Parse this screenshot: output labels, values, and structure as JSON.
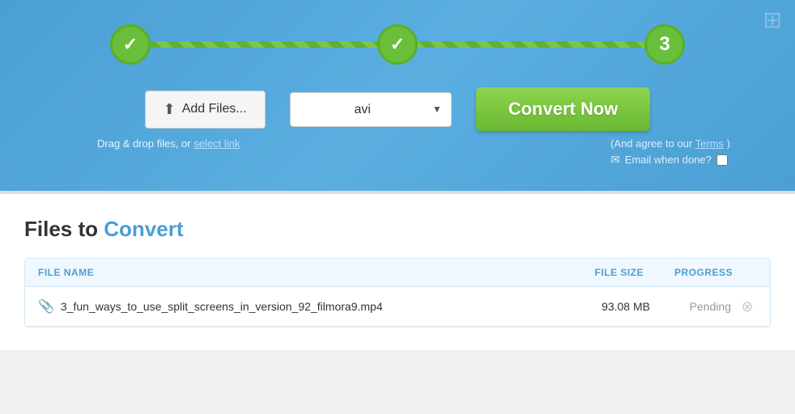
{
  "banner": {
    "steps": [
      {
        "id": 1,
        "state": "done",
        "label": "✓"
      },
      {
        "id": 2,
        "state": "done",
        "label": "✓"
      },
      {
        "id": 3,
        "state": "active",
        "label": "3"
      }
    ],
    "add_files_label": "Add Files...",
    "format_value": "avi",
    "convert_now_label": "Convert Now",
    "drag_drop_text": "Drag & drop files, or",
    "select_link_text": "select link",
    "terms_text": "(And agree to our",
    "terms_link_text": "Terms",
    "terms_close": ")",
    "email_label": "Email when done?"
  },
  "files_section": {
    "heading_part1": "Files to ",
    "heading_part2": "Convert",
    "table": {
      "col_filename": "FILE NAME",
      "col_filesize": "FILE SIZE",
      "col_progress": "PROGRESS",
      "rows": [
        {
          "filename": "3_fun_ways_to_use_split_screens_in_version_92_filmora9.mp4",
          "filesize": "93.08 MB",
          "progress": "Pending"
        }
      ]
    }
  }
}
